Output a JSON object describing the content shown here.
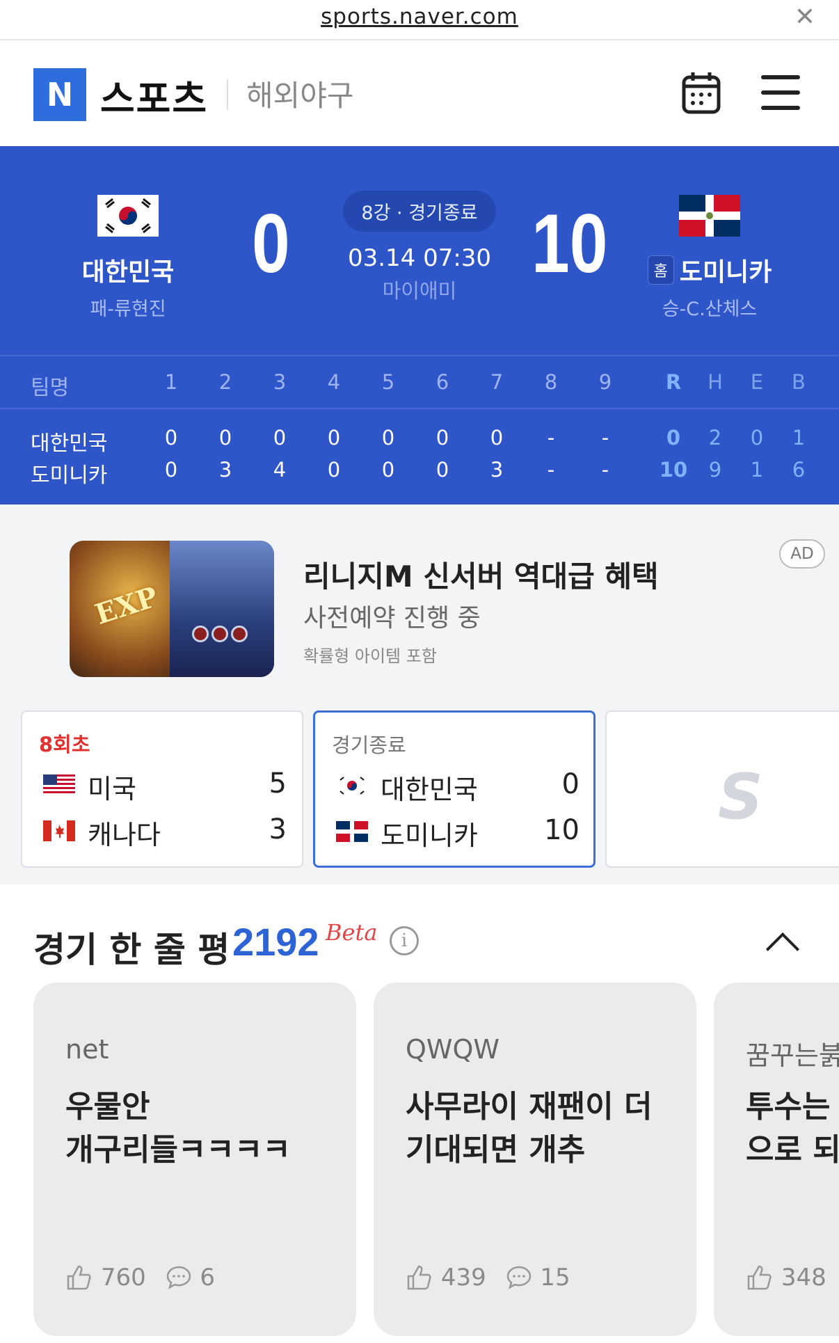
{
  "browser": {
    "url": "sports.naver.com"
  },
  "header": {
    "logo": "N",
    "brand": "스포츠",
    "section": "해외야구"
  },
  "match": {
    "home": {
      "name": "대한민국",
      "pitcher": "패-류현진",
      "score": "0"
    },
    "away": {
      "name": "도미니카",
      "pitcher": "승-C.산체스",
      "score": "10",
      "badge": "홈"
    },
    "status": "8강 · 경기종료",
    "datetime": "03.14 07:30",
    "venue": "마이애미"
  },
  "linescore": {
    "head": {
      "team": "팀명",
      "innings": [
        "1",
        "2",
        "3",
        "4",
        "5",
        "6",
        "7",
        "8",
        "9"
      ],
      "totals": [
        "R",
        "H",
        "E",
        "B"
      ]
    },
    "rows": [
      {
        "team": "대한민국",
        "innings": [
          "0",
          "0",
          "0",
          "0",
          "0",
          "0",
          "0",
          "-",
          "-"
        ],
        "totals": [
          "0",
          "2",
          "0",
          "1"
        ]
      },
      {
        "team": "도미니카",
        "innings": [
          "0",
          "3",
          "4",
          "0",
          "0",
          "0",
          "3",
          "-",
          "-"
        ],
        "totals": [
          "10",
          "9",
          "1",
          "6"
        ]
      }
    ]
  },
  "ad": {
    "title": "리니지M 신서버 역대급 혜택",
    "subtitle": "사전예약 진행 중",
    "note": "확률형 아이템 포함",
    "badge": "AD",
    "image_text": "EXP"
  },
  "games": [
    {
      "status": "8회초",
      "teams": [
        {
          "name": "미국",
          "score": "5"
        },
        {
          "name": "캐나다",
          "score": "3"
        }
      ]
    },
    {
      "status": "경기종료",
      "teams": [
        {
          "name": "대한민국",
          "score": "0"
        },
        {
          "name": "도미니카",
          "score": "10"
        }
      ]
    }
  ],
  "comments": {
    "title": "경기 한 줄 평",
    "count": "2192",
    "beta": "Beta",
    "items": [
      {
        "author": "net",
        "text": "우물안 개구리들ㅋㅋㅋㅋ",
        "likes": "760",
        "replies": "6"
      },
      {
        "author": "QWQW",
        "text": "사무라이 재팬이 더 기대되면 개추",
        "likes": "439",
        "replies": "15"
      },
      {
        "author": "꿈꾸는붉",
        "text": "투수는 이닝바 으로 되",
        "likes": "348",
        "replies": ""
      }
    ]
  },
  "colors": {
    "primary": "#2f56c9",
    "accent": "#2e63d6",
    "live": "#e03030"
  },
  "icons": [
    "close-icon",
    "calendar-icon",
    "menu-icon",
    "info-icon",
    "chevron-up-icon",
    "thumbs-up-icon",
    "comment-icon"
  ]
}
